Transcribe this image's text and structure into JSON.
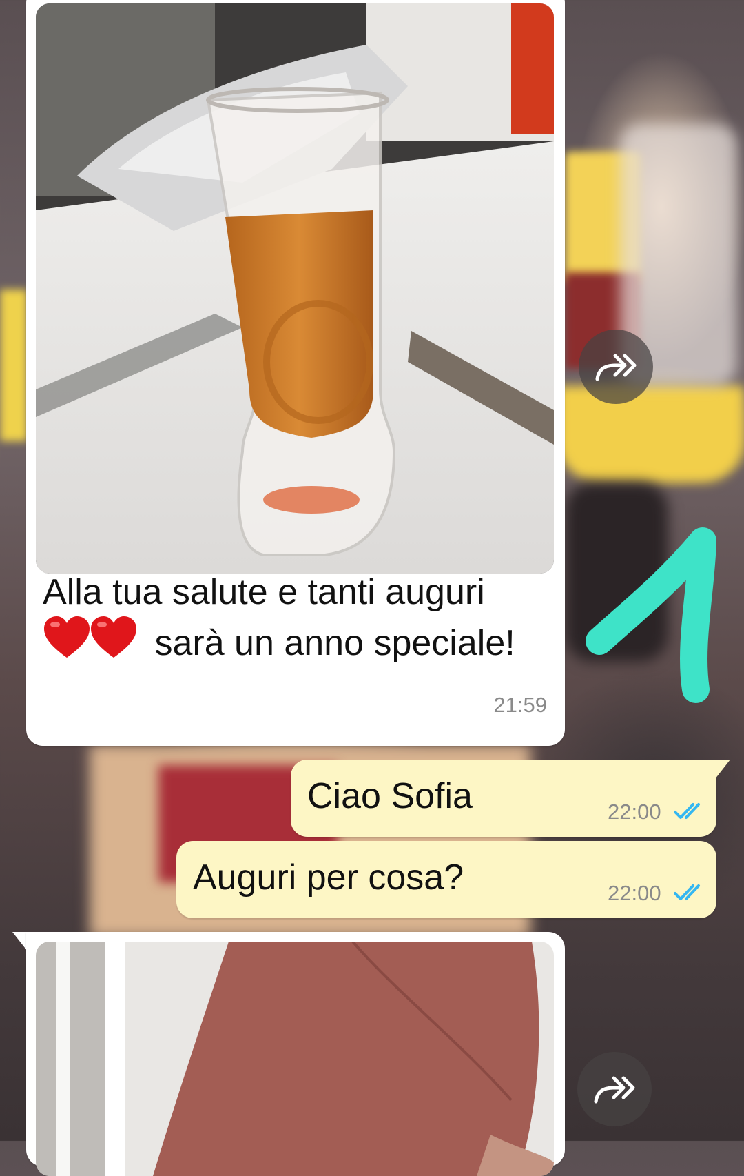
{
  "messages": [
    {
      "direction": "incoming",
      "media": "photo",
      "caption_line1": "Alla tua salute e tanti auguri",
      "caption_line2_emoji": "❤️❤️",
      "caption_line2": "sarà un anno speciale!",
      "time": "21:59"
    },
    {
      "direction": "outgoing",
      "text": "Ciao Sofia",
      "time": "22:00",
      "status": "read"
    },
    {
      "direction": "outgoing",
      "text": "Auguri per cosa?",
      "time": "22:00",
      "status": "read"
    },
    {
      "direction": "incoming",
      "media": "photo"
    }
  ],
  "icons": {
    "forward": "forward-icon",
    "read_receipt": "double-check-icon",
    "emoji": "red-heart-emoji"
  },
  "colors": {
    "incoming_bubble": "#ffffff",
    "outgoing_bubble": "#fdf6c5",
    "read_ticks": "#34b7f1",
    "drawn_mark": "#3ee3c8"
  }
}
